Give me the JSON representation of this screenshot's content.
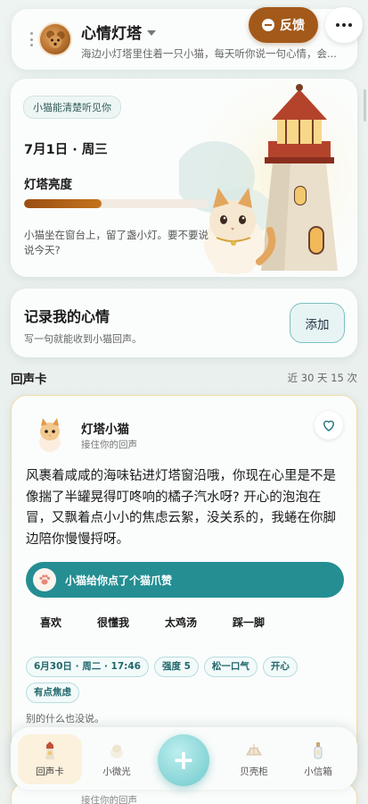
{
  "header": {
    "title": "心情灯塔",
    "subtitle": "海边小灯塔里住着一只小猫，每天听你说一句心情，会...",
    "feedback_label": "反馈"
  },
  "hero": {
    "hint": "小猫能清楚听见你",
    "date": "7月1日 · 周三",
    "brightness_label": "灯塔亮度",
    "brightness_level": 0.42,
    "message": "小猫坐在窗台上，留了盏小灯。要不要说说今天?"
  },
  "record": {
    "title": "记录我的心情",
    "subtitle": "写一句就能收到小猫回声。",
    "add_label": "添加"
  },
  "echo_section": {
    "title": "回声卡",
    "meta": "近 30 天 15 次"
  },
  "echo_card": {
    "name": "灯塔小猫",
    "sub": "接住你的回声",
    "text": "风裹着咸咸的海味钻进灯塔窗沿哦，你现在心里是不是像揣了半罐晃得叮咚响的橘子汽水呀? 开心的泡泡在冒，又飘着点小小的焦虑云絮，没关系的，我蜷在你脚边陪你慢慢捋呀。",
    "paw_label": "小猫给你点了个猫爪赞",
    "reactions": [
      "喜欢",
      "很懂我",
      "太鸡汤",
      "踩一脚"
    ],
    "tags": [
      "6月30日 · 周二 · 17:46",
      "强度 5",
      "松一口气",
      "开心",
      "有点焦虑"
    ],
    "nothing_else": "别的什么也没说。"
  },
  "peek_card": {
    "sub": "接住你的回声"
  },
  "nav": {
    "items": [
      {
        "label": "回声卡",
        "icon": "lighthouse-icon"
      },
      {
        "label": "小微光",
        "icon": "glow-icon"
      },
      {
        "label": "贝壳柜",
        "icon": "shell-icon"
      },
      {
        "label": "小信箱",
        "icon": "bottle-icon"
      }
    ],
    "fab": "+"
  },
  "colors": {
    "accent": "#248e93",
    "brand_brown": "#a3591a",
    "tag_border": "#b8dcdf"
  }
}
